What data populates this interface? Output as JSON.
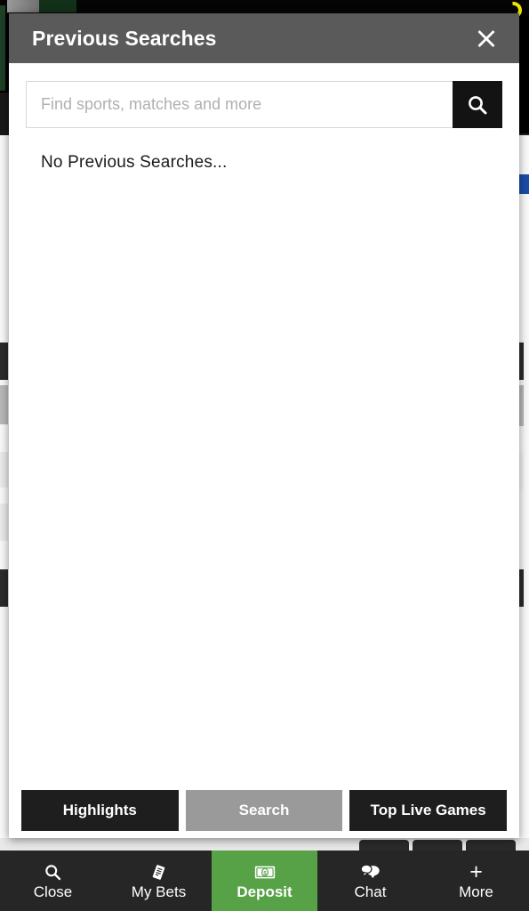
{
  "modal": {
    "title": "Previous Searches",
    "close_icon": "close-icon",
    "close_label": "Close dialog",
    "search": {
      "placeholder": "Find sports, matches and more",
      "value": "",
      "submit_icon": "search-icon",
      "submit_label": "Search"
    },
    "empty_message": "No Previous Searches...",
    "tabs": [
      {
        "label": "Highlights",
        "active": false
      },
      {
        "label": "Search",
        "active": true
      },
      {
        "label": "Top Live Games",
        "active": false
      }
    ]
  },
  "bottom_nav": {
    "items": [
      {
        "label": "Close",
        "icon": "search-icon",
        "highlight": false
      },
      {
        "label": "My Bets",
        "icon": "receipt-icon",
        "highlight": false
      },
      {
        "label": "Deposit",
        "icon": "banknote-icon",
        "highlight": true
      },
      {
        "label": "Chat",
        "icon": "chat-icon",
        "highlight": false
      },
      {
        "label": "More",
        "icon": "plus-icon",
        "highlight": false
      }
    ]
  },
  "colors": {
    "header_grey": "#5a5a5a",
    "modal_white": "#ffffff",
    "tab_dark": "#1e1e1e",
    "tab_active_grey": "#9a9a9a",
    "nav_dark": "#262626",
    "deposit_green": "#57a246",
    "accent_yellow": "#f3e600",
    "accent_blue": "#1b4da8",
    "brand_green": "#1d4026",
    "page_black": "#000000"
  }
}
